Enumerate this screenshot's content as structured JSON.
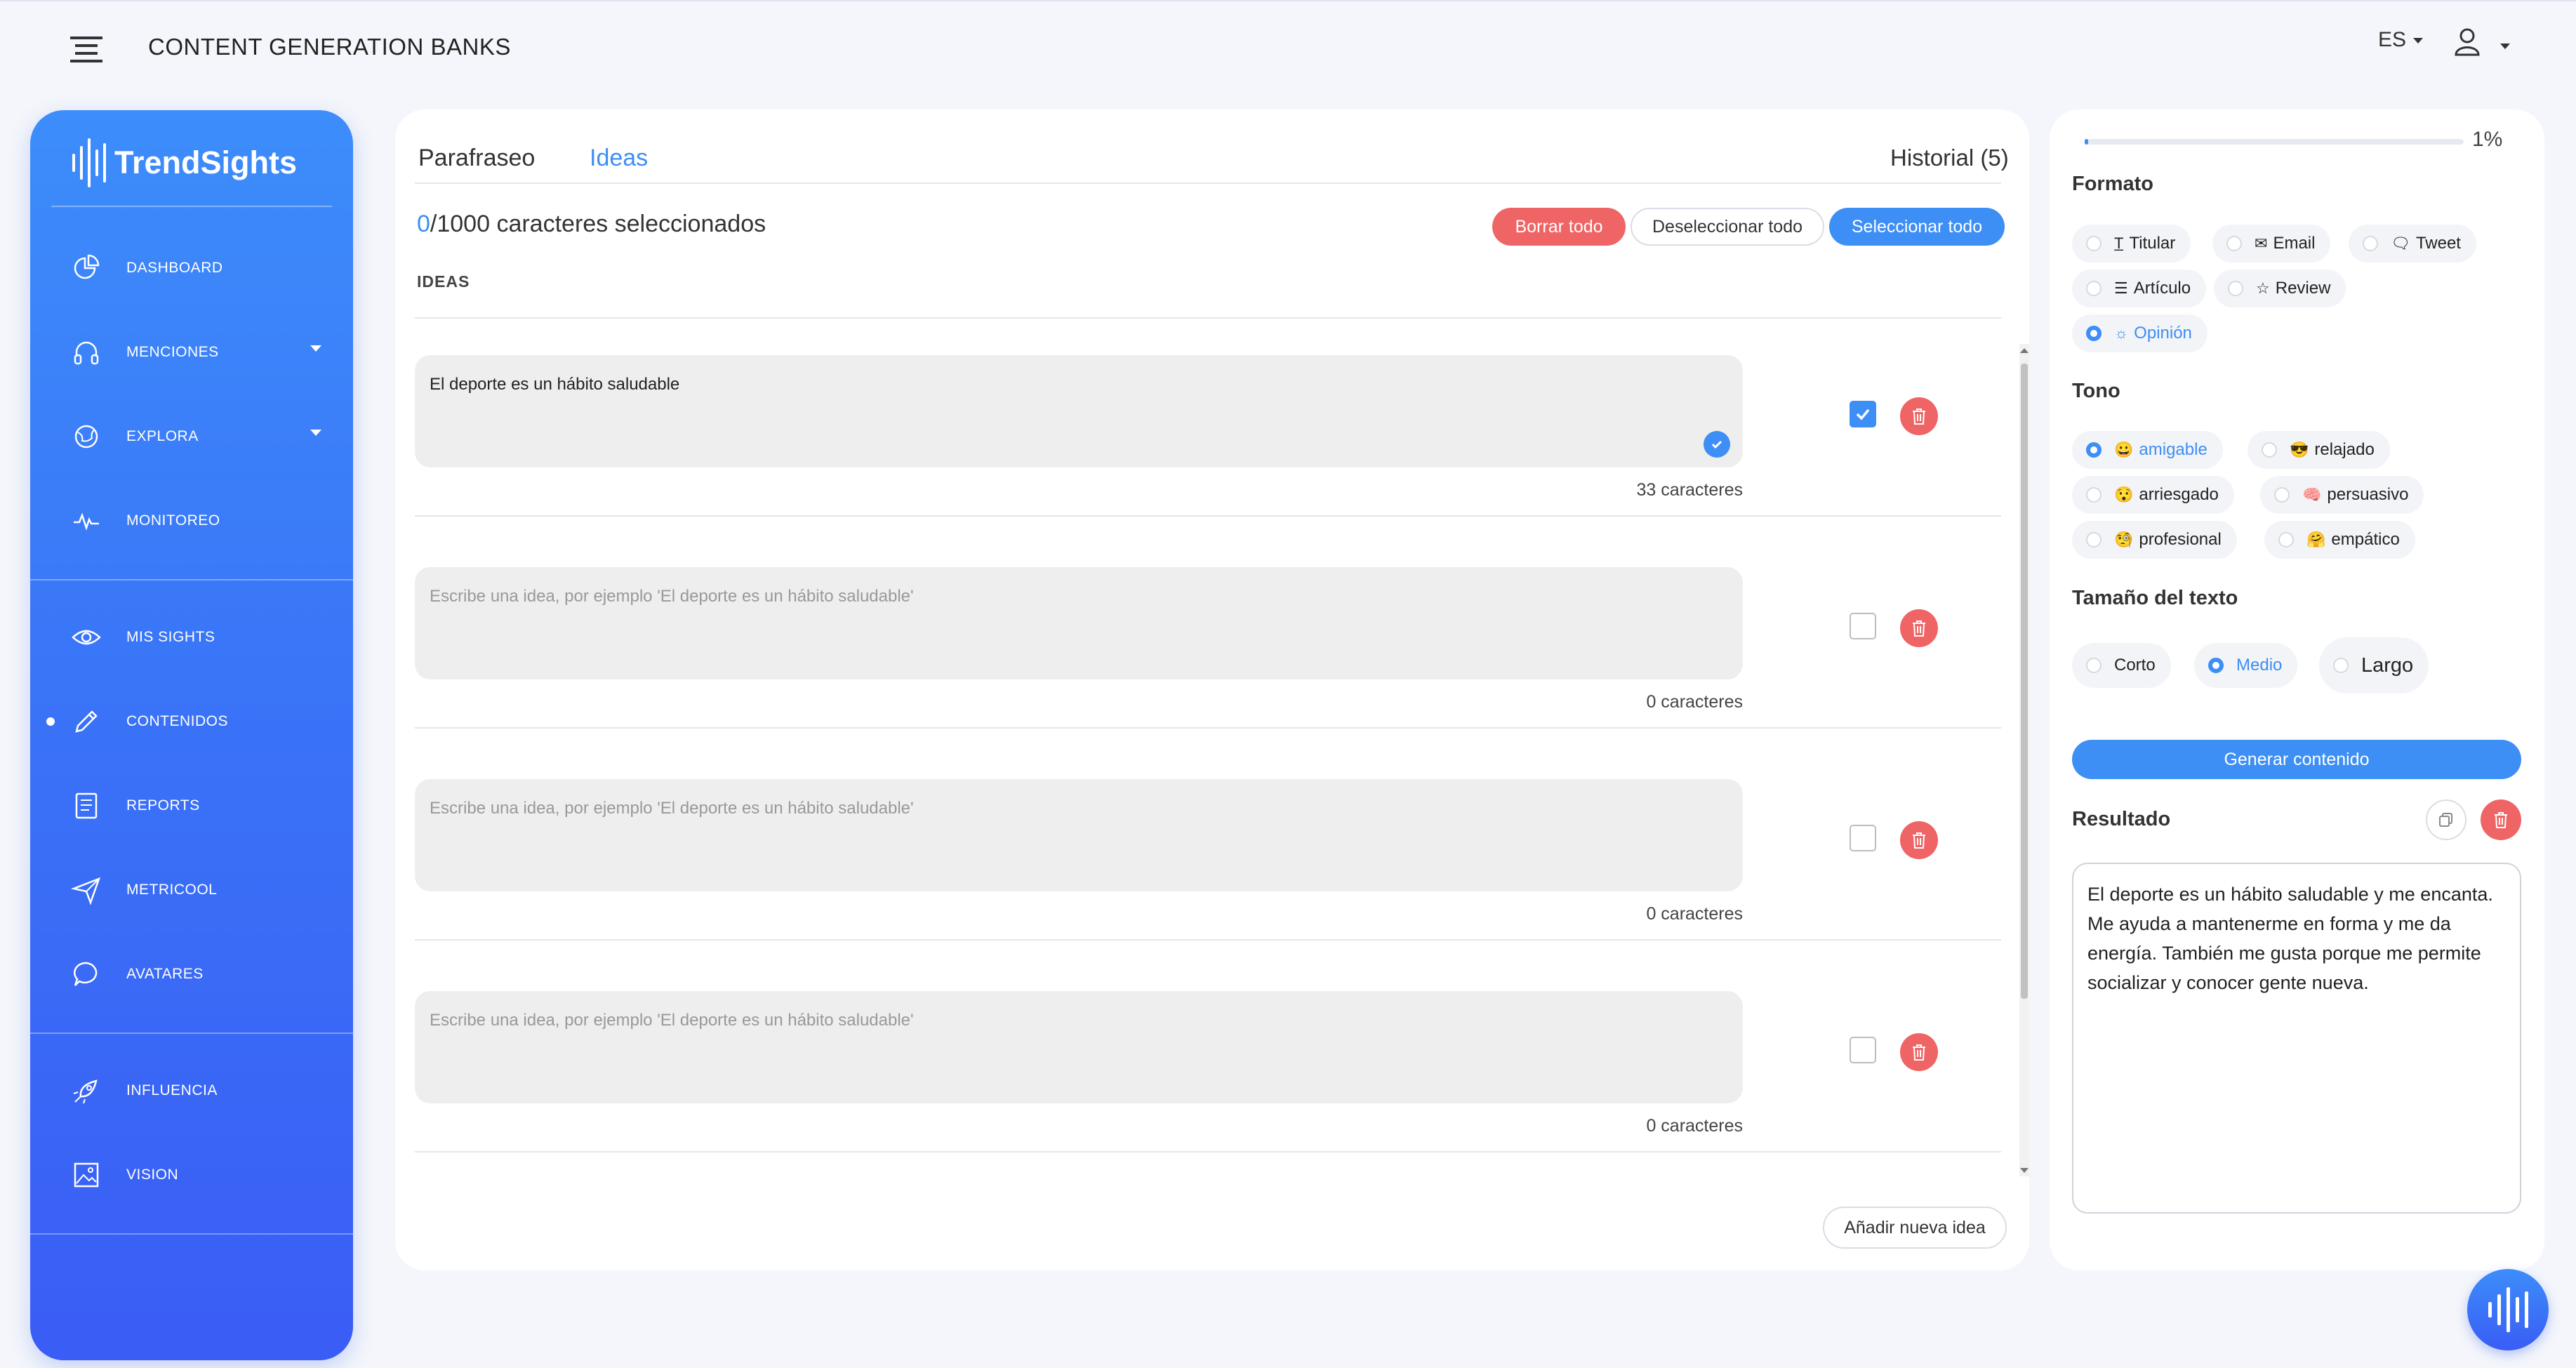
{
  "header": {
    "title": "CONTENT GENERATION BANKS",
    "language": "ES"
  },
  "sidebar": {
    "logo_text": "TrendSights",
    "items": [
      {
        "label": "DASHBOARD",
        "icon": "pie-chart-icon"
      },
      {
        "label": "MENCIONES",
        "icon": "headphones-icon"
      },
      {
        "label": "EXPLORA",
        "icon": "globe-icon"
      },
      {
        "label": "MONITOREO",
        "icon": "pulse-icon"
      },
      {
        "label": "MIS SIGHTS",
        "icon": "eye-icon"
      },
      {
        "label": "CONTENIDOS",
        "icon": "pencil-icon"
      },
      {
        "label": "REPORTS",
        "icon": "document-icon"
      },
      {
        "label": "METRICOOL",
        "icon": "send-icon"
      },
      {
        "label": "AVATARES",
        "icon": "chat-icon"
      },
      {
        "label": "INFLUENCIA",
        "icon": "rocket-icon"
      },
      {
        "label": "VISION",
        "icon": "image-icon"
      }
    ]
  },
  "main": {
    "tabs": [
      "Parafraseo",
      "Ideas"
    ],
    "history": "Historial (5)",
    "selected_count": "0",
    "selected_suffix": "/1000 caracteres seleccionados",
    "buttons": {
      "clear_all": "Borrar todo",
      "deselect_all": "Deseleccionar todo",
      "select_all": "Seleccionar todo",
      "add_idea": "Añadir nueva idea"
    },
    "ideas_heading": "IDEAS",
    "placeholder": "Escribe una idea, por ejemplo 'El deporte es un hábito saludable'",
    "ideas": [
      {
        "text": "El deporte es un hábito saludable",
        "count": "33 caracteres",
        "checked": true
      },
      {
        "text": "",
        "count": "0 caracteres",
        "checked": false
      },
      {
        "text": "",
        "count": "0 caracteres",
        "checked": false
      },
      {
        "text": "",
        "count": "0 caracteres",
        "checked": false
      }
    ]
  },
  "panel": {
    "progress_pct": "1%",
    "progress_value": 0.01,
    "format_label": "Formato",
    "formats": [
      "Titular",
      "Email",
      "Tweet",
      "Artículo",
      "Review",
      "Opinión"
    ],
    "tone_label": "Tono",
    "tones": [
      "amigable",
      "relajado",
      "arriesgado",
      "persuasivo",
      "profesional",
      "empático"
    ],
    "tone_emojis": [
      "😀",
      "😎",
      "😯",
      "🧠",
      "🧐",
      "🤗"
    ],
    "size_label": "Tamaño del texto",
    "sizes": [
      "Corto",
      "Medio",
      "Largo"
    ],
    "generate_button": "Generar contenido",
    "result_label": "Resultado",
    "result_text": "El deporte es un hábito saludable y me encanta. Me ayuda a mantenerme en forma y me da energía. También me gusta porque me permite socializar y conocer gente nueva."
  },
  "colors": {
    "accent": "#3d8ef5",
    "danger": "#ef6464",
    "sidebar_top": "#3d8dfb",
    "sidebar_bottom": "#3a5df5"
  }
}
